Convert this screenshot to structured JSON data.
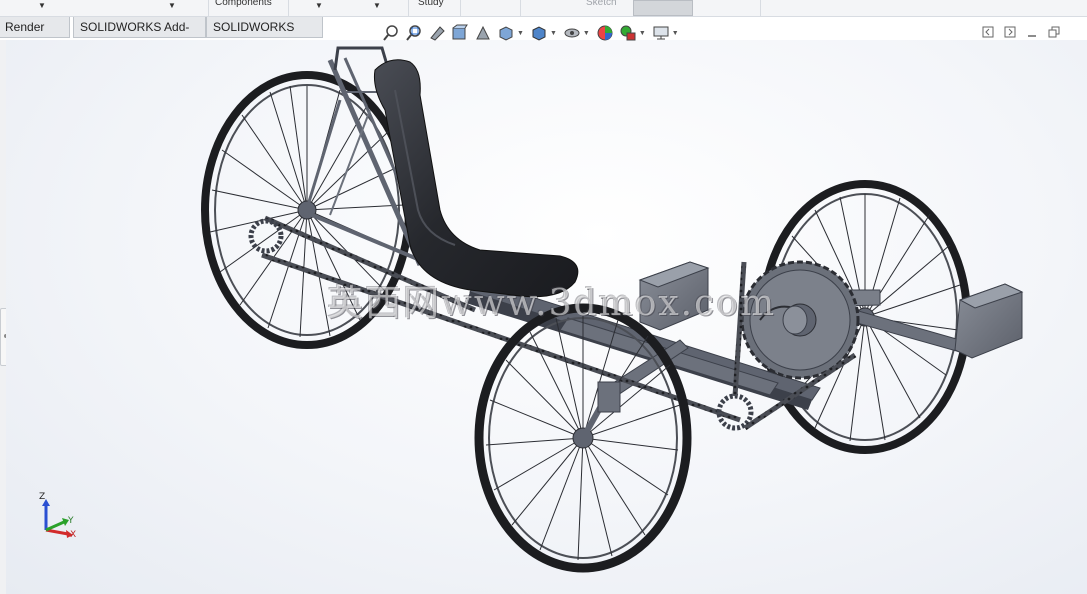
{
  "ribbon": {
    "components_label": "Components",
    "study_label": "Study",
    "sketch_label": "Sketch"
  },
  "tabs": [
    {
      "label": "Render Tools"
    },
    {
      "label": "SOLIDWORKS Add-Ins"
    },
    {
      "label": "SOLIDWORKS MBD"
    }
  ],
  "heads_up_toolbar": {
    "icons": [
      "zoom-to-fit-icon",
      "zoom-to-area-icon",
      "previous-view-icon",
      "section-view-icon",
      "dynamic-annotation-icon",
      "view-orientation-icon",
      "display-style-icon",
      "hide-show-items-icon",
      "edit-appearance-icon",
      "apply-scene-icon",
      "view-settings-icon"
    ]
  },
  "watermark": "英西网www.3dmox.com",
  "triad": {
    "x": "X",
    "y": "Y",
    "z": "Z"
  },
  "colors": {
    "frame": "#5f6470",
    "frame_dark": "#3c404a",
    "seat": "#2a2c31",
    "tire": "#1c1d20",
    "spoke": "#2b2d33",
    "axis_x": "#d22b2b",
    "axis_y": "#2aa12a",
    "axis_z": "#2a4fd2"
  }
}
